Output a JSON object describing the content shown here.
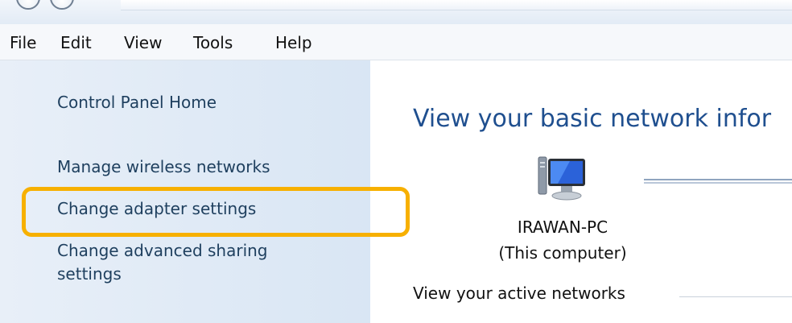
{
  "menubar": {
    "items": [
      "File",
      "Edit",
      "View",
      "Tools",
      "Help"
    ]
  },
  "sidebar": {
    "home": "Control Panel Home",
    "links": [
      "Manage wireless networks",
      "Change adapter settings",
      "Change advanced sharing",
      "settings"
    ]
  },
  "main": {
    "title": "View your basic network infor",
    "computer": {
      "name": "IRAWAN-PC",
      "subtitle": "(This computer)"
    },
    "active_networks_label": "View your active networks"
  },
  "colors": {
    "highlight": "#f7b000",
    "link": "#1e3f5e",
    "title": "#1f4f8f"
  }
}
